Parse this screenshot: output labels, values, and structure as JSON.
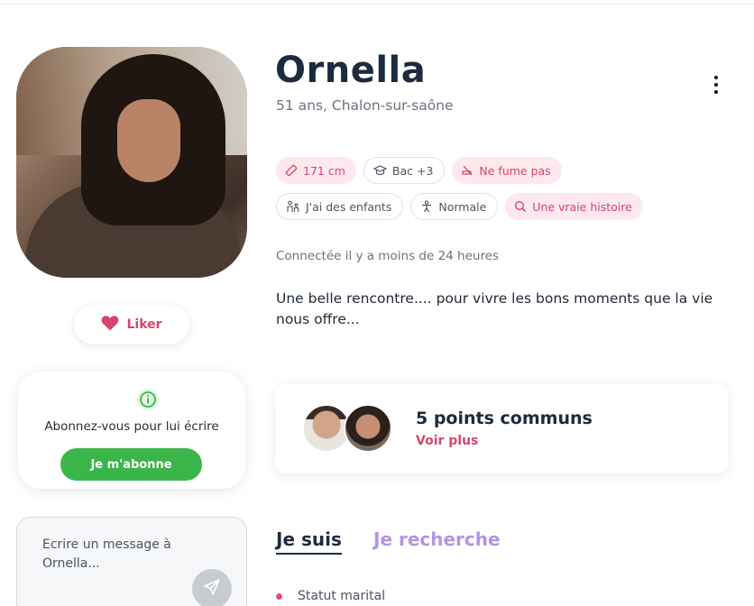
{
  "profile": {
    "name": "Ornella",
    "subtitle": "51 ans, Chalon-sur-saône",
    "last_seen": "Connectée il y a moins de 24 heures",
    "bio": "Une belle rencontre.... pour vivre les bons moments que la vie nous offre..."
  },
  "tags": [
    {
      "label": "171 cm",
      "icon": "ruler-icon",
      "style": "pink"
    },
    {
      "label": "Bac +3",
      "icon": "graduation-cap-icon",
      "style": "grey"
    },
    {
      "label": "Ne fume pas",
      "icon": "no-smoking-icon",
      "style": "pink"
    },
    {
      "label": "J'ai des enfants",
      "icon": "family-icon",
      "style": "grey"
    },
    {
      "label": "Normale",
      "icon": "body-type-icon",
      "style": "grey"
    },
    {
      "label": "Une vraie histoire",
      "icon": "search-icon",
      "style": "pink"
    }
  ],
  "like_button": {
    "label": "Liker",
    "icon": "heart-icon"
  },
  "subscribe": {
    "text": "Abonnez-vous pour lui écrire",
    "button": "Je m'abonne",
    "icon": "info-icon"
  },
  "message": {
    "placeholder": "Ecrire un message à Ornella..."
  },
  "common_points": {
    "title": "5 points communs",
    "link": "Voir plus"
  },
  "tabs": [
    {
      "label": "Je suis",
      "active": true
    },
    {
      "label": "Je recherche",
      "active": false
    }
  ],
  "fields": [
    {
      "label": "Statut marital"
    }
  ],
  "colors": {
    "accent_pink": "#d6456b",
    "pink_bg": "#fde8ee",
    "green": "#3bb54a",
    "navy": "#1c2b3f",
    "tab_inactive": "#b593e6"
  }
}
